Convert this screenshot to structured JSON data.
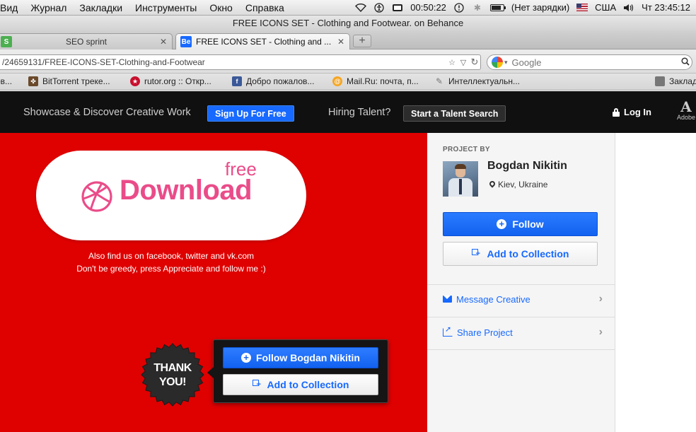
{
  "menubar": {
    "items": [
      "Вид",
      "Журнал",
      "Закладки",
      "Инструменты",
      "Окно",
      "Справка"
    ],
    "clock_elapsed": "00:50:22",
    "battery_status": "(Нет зарядки)",
    "input_language": "США",
    "datetime": "Чт 23:45:12",
    "battery_level": 0.85
  },
  "window": {
    "title": "FREE ICONS SET - Clothing and Footwear. on Behance"
  },
  "tabs": [
    {
      "label": "SEO sprint",
      "favicon": "S",
      "favicon_color": "#4caf50",
      "active": false
    },
    {
      "label": "FREE ICONS SET - Clothing and ...",
      "favicon": "Be",
      "favicon_color": "#1769ff",
      "active": true
    }
  ],
  "toolbar": {
    "url": "/24659131/FREE-ICONS-SET-Clothing-and-Footwear",
    "search_placeholder": "Google"
  },
  "bookmarks": [
    {
      "label": "ов...",
      "icon": "",
      "color": ""
    },
    {
      "label": "BitTorrent треке...",
      "icon": "bittorrent-icon",
      "color": "#6b4a2b"
    },
    {
      "label": "rutor.org :: Откр...",
      "icon": "star-icon",
      "color": "#c8102e"
    },
    {
      "label": "Добро пожалов...",
      "icon": "facebook-icon",
      "color": "#3b5998"
    },
    {
      "label": "Mail.Ru: почта, п...",
      "icon": "mailru-icon",
      "color": "#f5a623"
    },
    {
      "label": "Интеллектуальн...",
      "icon": "paperclip-icon",
      "color": "#888888"
    },
    {
      "label": "Заклад",
      "icon": "folder-icon",
      "color": "#777777"
    }
  ],
  "behance": {
    "tagline": "Showcase & Discover Creative Work",
    "signup_label": "Sign Up For Free",
    "hiring_label": "Hiring Talent?",
    "talent_search_label": "Start a Talent Search",
    "login_label": "Log In",
    "adobe_label": "Adobe"
  },
  "artwork": {
    "download_label": "Download",
    "free_label": "free",
    "line1": "Also find us on facebook, twitter and vk.com",
    "line2": "Don't be greedy, press Appreciate and follow me :)",
    "thanks_line1": "THANK",
    "thanks_line2": "YOU!",
    "follow_label": "Follow Bogdan Nikitin",
    "add_label": "Add to Collection"
  },
  "sidebar": {
    "project_by_label": "PROJECT BY",
    "owner_name": "Bogdan Nikitin",
    "owner_location": "Kiev, Ukraine",
    "follow_label": "Follow",
    "add_label": "Add to Collection",
    "message_label": "Message Creative",
    "share_label": "Share Project"
  },
  "colors": {
    "behance_blue": "#1769ff",
    "artwork_red": "#df0000",
    "dribbble_pink": "#ea4c89"
  }
}
